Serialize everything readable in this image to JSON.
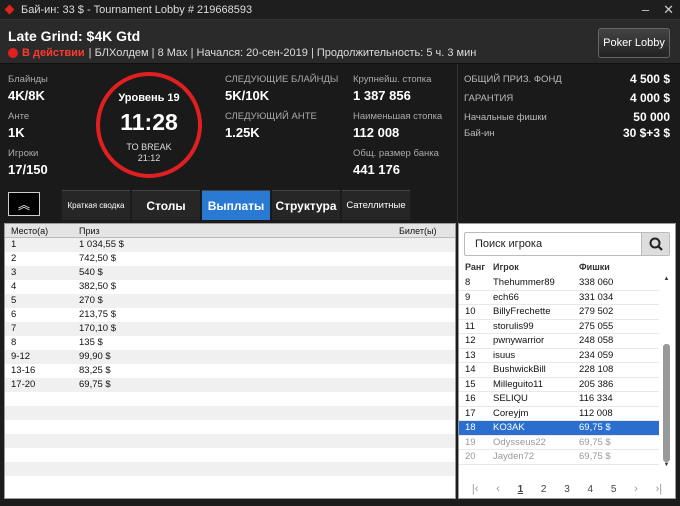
{
  "window": {
    "title": "Бай-ин: 33 $ - Tournament Lobby # 219668593"
  },
  "header": {
    "name": "Late Grind: $4K Gtd",
    "status": "В действии",
    "details": "| БЛХолдем | 8 Max | Начался: 20-сен-2019 | Продолжительность: 5 ч. 3 мин",
    "lobby_button": "Poker Lobby"
  },
  "stats": {
    "blinds_label": "Блайнды",
    "blinds": "4K/8K",
    "ante_label": "Анте",
    "ante": "1K",
    "players_label": "Игроки",
    "players": "17/150",
    "next_blinds_label": "СЛЕДУЮЩИЕ БЛАЙНДЫ",
    "next_blinds": "5K/10K",
    "next_ante_label": "СЛЕДУЮЩИЙ АНТЕ",
    "next_ante": "1.25K",
    "largest_label": "Крупнейш. стопка",
    "largest": "1 387 856",
    "smallest_label": "Наименьшая стопка",
    "smallest": "112 008",
    "avg_label": "Общ. размер банка",
    "avg": "441 176"
  },
  "clock": {
    "level": "Уровень 19",
    "time": "11:28",
    "break_label": "TO BREAK",
    "break_time": "21:12"
  },
  "prize": {
    "pool_label": "ОБЩИЙ ПРИЗ. ФОНД",
    "pool": "4 500 $",
    "guarantee_label": "ГАРАНТИЯ",
    "guarantee": "4 000 $",
    "chips_label": "Начальные фишки",
    "chips": "50 000",
    "buyin_label": "Бай-ин",
    "buyin": "30 $+3 $"
  },
  "tabs": [
    "Краткая сводка",
    "Столы",
    "Выплаты",
    "Структура",
    "Сателлитные"
  ],
  "payouts": {
    "headers": [
      "Место(а)",
      "Приз",
      "Билет(ы)"
    ],
    "rows": [
      [
        "1",
        "1 034,55 $"
      ],
      [
        "2",
        "742,50 $"
      ],
      [
        "3",
        "540 $"
      ],
      [
        "4",
        "382,50 $"
      ],
      [
        "5",
        "270 $"
      ],
      [
        "6",
        "213,75 $"
      ],
      [
        "7",
        "170,10 $"
      ],
      [
        "8",
        "135 $"
      ],
      [
        "9-12",
        "99,90 $"
      ],
      [
        "13-16",
        "83,25 $"
      ],
      [
        "17-20",
        "69,75 $"
      ]
    ]
  },
  "players": {
    "search_placeholder": "Поиск игрока",
    "headers": [
      "Ранг",
      "Игрок",
      "Фишки"
    ],
    "rows": [
      [
        "8",
        "Thehummer89",
        "338 060"
      ],
      [
        "9",
        "ech66",
        "331 034"
      ],
      [
        "10",
        "BillyFrechette",
        "279 502"
      ],
      [
        "11",
        "storulis99",
        "275 055"
      ],
      [
        "12",
        "pwnywarrior",
        "248 058"
      ],
      [
        "13",
        "isuus",
        "234 059"
      ],
      [
        "14",
        "BushwickBill",
        "228 108"
      ],
      [
        "15",
        "Milleguito11",
        "205 386"
      ],
      [
        "16",
        "SELIQU",
        "116 334"
      ],
      [
        "17",
        "Coreyjm",
        "112 008"
      ],
      [
        "18",
        "KO3AK",
        "69,75 $"
      ],
      [
        "19",
        "Odysseus22",
        "69,75 $"
      ],
      [
        "20",
        "Jayden72",
        "69,75 $"
      ]
    ],
    "pages": [
      "1",
      "2",
      "3",
      "4",
      "5"
    ]
  }
}
